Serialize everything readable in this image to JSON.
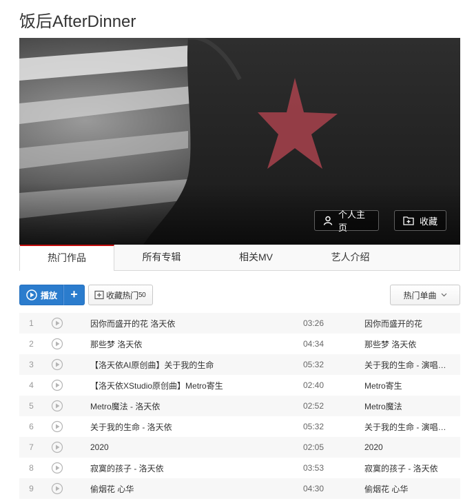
{
  "artist": {
    "name": "饭后AfterDinner"
  },
  "banner": {
    "home_label": "个人主页",
    "fav_label": "收藏"
  },
  "tabs": [
    {
      "label": "热门作品",
      "active": true
    },
    {
      "label": "所有专辑",
      "active": false
    },
    {
      "label": "相关MV",
      "active": false
    },
    {
      "label": "艺人介绍",
      "active": false
    }
  ],
  "toolbar": {
    "play_label": "播放",
    "add_label": "+",
    "collect_label": "收藏热门",
    "collect_count": "50",
    "sort_label": "热门单曲"
  },
  "songs": [
    {
      "index": "1",
      "title": "因你而盛开的花 洛天依",
      "duration": "03:26",
      "album": "因你而盛开的花"
    },
    {
      "index": "2",
      "title": "那些梦 洛天依",
      "duration": "04:34",
      "album": "那些梦 洛天依"
    },
    {
      "index": "3",
      "title": "【洛天依AI原创曲】关于我的生命",
      "duration": "05:32",
      "album": "关于我的生命 - 演唱…"
    },
    {
      "index": "4",
      "title": "【洛天依XStudio原创曲】Metro寄生",
      "duration": "02:40",
      "album": "Metro寄生"
    },
    {
      "index": "5",
      "title": "Metro魔法 - 洛天依",
      "duration": "02:52",
      "album": "Metro魔法"
    },
    {
      "index": "6",
      "title": "关于我的生命 - 洛天依",
      "duration": "05:32",
      "album": "关于我的生命 - 演唱…"
    },
    {
      "index": "7",
      "title": "2020",
      "duration": "02:05",
      "album": "2020"
    },
    {
      "index": "8",
      "title": "寂寞的孩子 - 洛天依",
      "duration": "03:53",
      "album": "寂寞的孩子 - 洛天依"
    },
    {
      "index": "9",
      "title": "偷烟花 心华",
      "duration": "04:30",
      "album": "偷烟花 心华"
    }
  ],
  "colors": {
    "accent_red": "#c20c0c",
    "play_blue": "#2b7ccd",
    "star": "#b0454f"
  },
  "icons": {
    "home": "user-icon",
    "fav": "folder-add-icon",
    "play": "play-circle-icon",
    "collect": "folder-add-icon",
    "sort": "chevron-down-icon",
    "row_play": "play-circle-icon"
  }
}
